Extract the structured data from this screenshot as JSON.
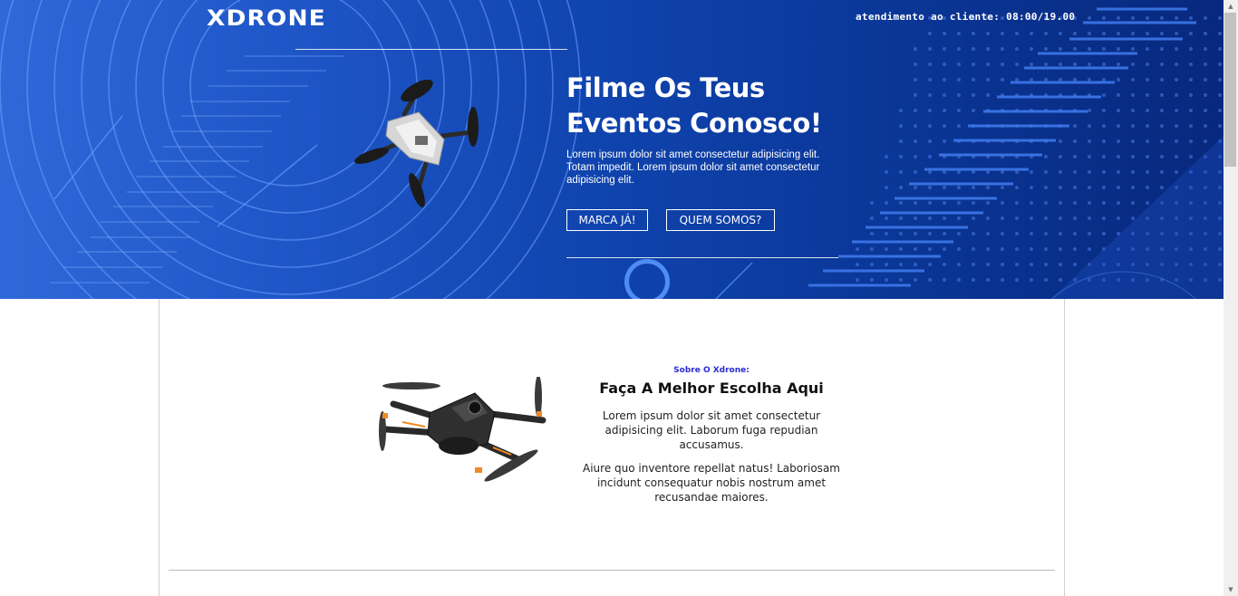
{
  "header": {
    "logo": "XDRONE",
    "service_hours": "atendimento ao cliente: 08:00/19.00"
  },
  "hero": {
    "title": "Filme Os Teus Eventos Conosco!",
    "text": "Lorem ipsum dolor sit amet consectetur adipisicing elit. Totam impedit. Lorem ipsum dolor sit amet consectetur adipisicing elit.",
    "primary_button": "MARCA JÁ!",
    "secondary_button": "QUEM SOMOS?"
  },
  "about": {
    "kicker": "Sobre O Xdrone:",
    "title": "Faça A Melhor Escolha Aqui",
    "paragraph1": "Lorem ipsum dolor sit amet consectetur adipisicing elit. Laborum fuga repudian accusamus.",
    "paragraph2": "Aiure quo inventore repellat natus! Laboriosam incidunt consequatur nobis nostrum amet recusandae maiores."
  },
  "icons": {
    "drone_hero": "drone-white-icon",
    "drone_about": "drone-black-icon"
  },
  "colors": {
    "hero_blue": "#0f43ad",
    "accent_blue": "#2a2ad6",
    "ring_blue": "#4f8df5"
  }
}
